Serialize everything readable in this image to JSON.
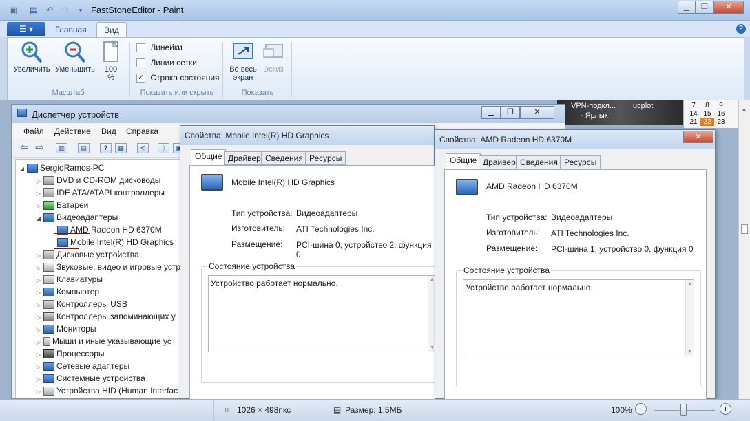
{
  "paint": {
    "title": "FastStoneEditor - Paint",
    "tabs": [
      {
        "label": "Главная"
      },
      {
        "label": "Вид"
      }
    ],
    "ribbon": {
      "zoom_in": "Увеличить",
      "zoom_out": "Уменьшить",
      "zoom_100_line1": "100",
      "zoom_100_line2": "%",
      "group_scale": "Масштаб",
      "rulers": "Линейки",
      "gridlines": "Линии сетки",
      "statusbar": "Строка состояния",
      "group_show": "Показать или скрыть",
      "fullscreen_line1": "Во весь",
      "fullscreen_line2": "экран",
      "thumbnail": "Эскиз",
      "group_display": "Показать"
    },
    "checkboxes": {
      "rulers": false,
      "gridlines": false,
      "statusbar": true
    },
    "status": {
      "dimensions": "1026 × 498пкс",
      "size": "Размер: 1,5МБ",
      "zoom": "100%",
      "minus": "−",
      "plus": "+"
    },
    "zoom_level": 100
  },
  "device_manager": {
    "title": "Диспетчер устройств",
    "menu": [
      "Файл",
      "Действие",
      "Вид",
      "Справка"
    ],
    "tree": [
      {
        "label": "SergioRamos-PC",
        "level": 0,
        "expander": "◢"
      },
      {
        "label": "DVD и CD-ROM дисководы",
        "level": 1,
        "expander": "▷"
      },
      {
        "label": "IDE ATA/ATAPI контроллеры",
        "level": 1,
        "expander": "▷"
      },
      {
        "label": "Батареи",
        "level": 1,
        "expander": "▷"
      },
      {
        "label": "Видеоадаптеры",
        "level": 1,
        "expander": "◢"
      },
      {
        "label": "AMD Radeon HD 6370M",
        "level": 2,
        "expander": ""
      },
      {
        "label": "Mobile Intel(R) HD Graphics",
        "level": 2,
        "expander": ""
      },
      {
        "label": "Дисковые устройства",
        "level": 1,
        "expander": "▷"
      },
      {
        "label": "Звуковые, видео и игровые устр",
        "level": 1,
        "expander": "▷"
      },
      {
        "label": "Клавиатуры",
        "level": 1,
        "expander": "▷"
      },
      {
        "label": "Компьютер",
        "level": 1,
        "expander": "▷"
      },
      {
        "label": "Контроллеры USB",
        "level": 1,
        "expander": "▷"
      },
      {
        "label": "Контроллеры запоминающих у",
        "level": 1,
        "expander": "▷"
      },
      {
        "label": "Мониторы",
        "level": 1,
        "expander": "▷"
      },
      {
        "label": "Мыши и иные указывающие ус",
        "level": 1,
        "expander": "▷"
      },
      {
        "label": "Процессоры",
        "level": 1,
        "expander": "▷"
      },
      {
        "label": "Сетевые адаптеры",
        "level": 1,
        "expander": "▷"
      },
      {
        "label": "Системные устройства",
        "level": 1,
        "expander": "▷"
      },
      {
        "label": "Устройства HID (Human Interfac",
        "level": 1,
        "expander": "▷"
      }
    ]
  },
  "dialog_intel": {
    "title": "Свойства: Mobile Intel(R) HD Graphics",
    "tabs": [
      "Общие",
      "Драйвер",
      "Сведения",
      "Ресурсы"
    ],
    "device_name": "Mobile Intel(R) HD Graphics",
    "type_label": "Тип устройства:",
    "type_value": "Видеоадаптеры",
    "maker_label": "Изготовитель:",
    "maker_value": "ATI Technologies Inc.",
    "location_label": "Размещение:",
    "location_value": "PCI-шина 0, устройство 2, функция 0",
    "status_group": "Состояние устройства",
    "status_text": "Устройство работает нормально."
  },
  "dialog_amd": {
    "title": "Свойства: AMD Radeon HD 6370M",
    "tabs": [
      "Общие",
      "Драйвер",
      "Сведения",
      "Ресурсы"
    ],
    "device_name": "AMD Radeon HD 6370M",
    "type_label": "Тип устройства:",
    "type_value": "Видеоадаптеры",
    "maker_label": "Изготовитель:",
    "maker_value": "ATI Technologies Inc.",
    "location_label": "Размещение:",
    "location_value": "PCI-шина 1, устройство 0, функция 0",
    "status_group": "Состояние устройства",
    "status_text": "Устройство работает нормально."
  },
  "desktop": {
    "shortcut1_line1": "VPN-подкл...",
    "shortcut1_line2": "- Ярлык",
    "shortcut2": "ucplot",
    "calendar": [
      [
        "7",
        "8",
        "9"
      ],
      [
        "14",
        "15",
        "16"
      ],
      [
        "21",
        "22",
        "23"
      ]
    ],
    "today": "22"
  },
  "colors": {
    "accent": "#2b63b2",
    "file_tab": "#1c56ad",
    "today": "#f07a18",
    "underline": "#8b1010"
  }
}
